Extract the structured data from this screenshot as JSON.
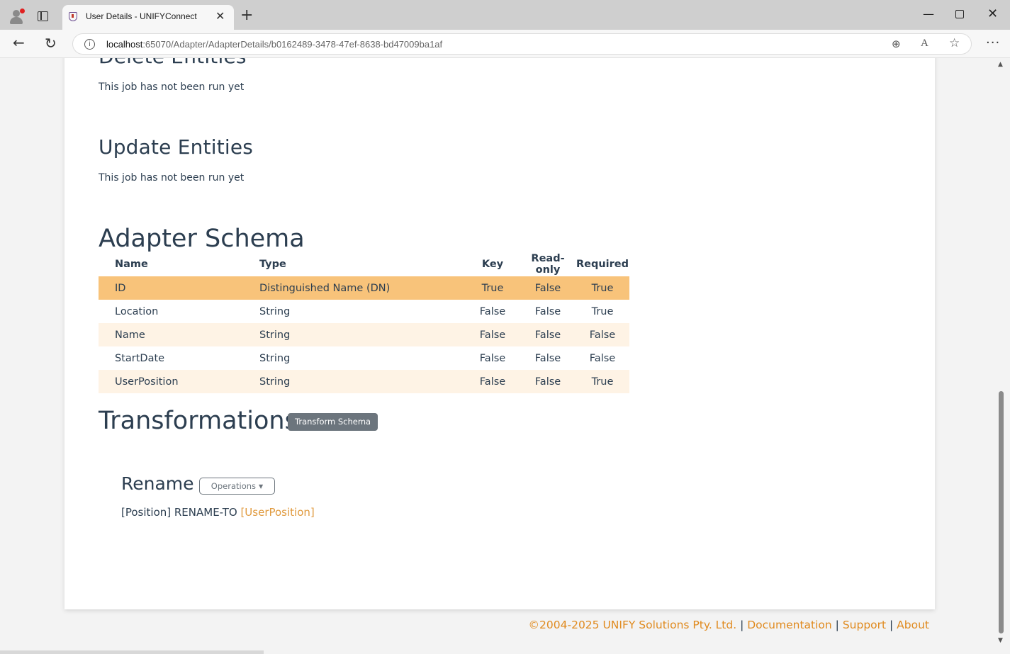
{
  "browser": {
    "tab_title": "User Details - UNIFYConnect",
    "url_host": "localhost",
    "url_rest": ":65070/Adapter/AdapterDetails/b0162489-3478-47ef-8638-bd47009ba1af",
    "new_tab_glyph": "+",
    "close_tab_glyph": "✕"
  },
  "sections": {
    "delete_entities": {
      "title": "Delete Entities",
      "status": "This job has not been run yet"
    },
    "update_entities": {
      "title": "Update Entities",
      "status": "This job has not been run yet"
    }
  },
  "schema": {
    "title": "Adapter Schema",
    "headers": {
      "name": "Name",
      "type": "Type",
      "key": "Key",
      "readonly": "Read-only",
      "required": "Required"
    },
    "rows": [
      {
        "name": "ID",
        "type": "Distinguished Name (DN)",
        "key": "True",
        "readonly": "False",
        "required": "True"
      },
      {
        "name": "Location",
        "type": "String",
        "key": "False",
        "readonly": "False",
        "required": "True"
      },
      {
        "name": "Name",
        "type": "String",
        "key": "False",
        "readonly": "False",
        "required": "False"
      },
      {
        "name": "StartDate",
        "type": "String",
        "key": "False",
        "readonly": "False",
        "required": "False"
      },
      {
        "name": "UserPosition",
        "type": "String",
        "key": "False",
        "readonly": "False",
        "required": "True"
      }
    ]
  },
  "transformations": {
    "title": "Transformations",
    "transform_button": "Transform Schema",
    "rename": {
      "title": "Rename",
      "operations_button": "Operations",
      "source": "[Position] RENAME-TO ",
      "target": "[UserPosition]"
    }
  },
  "footer": {
    "copyright": "©2004-2025 UNIFY Solutions Pty. Ltd.",
    "sep": " | ",
    "documentation": "Documentation",
    "support": "Support",
    "about": "About"
  },
  "colors": {
    "highlight_row": "#f8c37a",
    "striped_row": "#fef3e5",
    "link": "#e08a1e",
    "heading": "#2c3e50"
  }
}
